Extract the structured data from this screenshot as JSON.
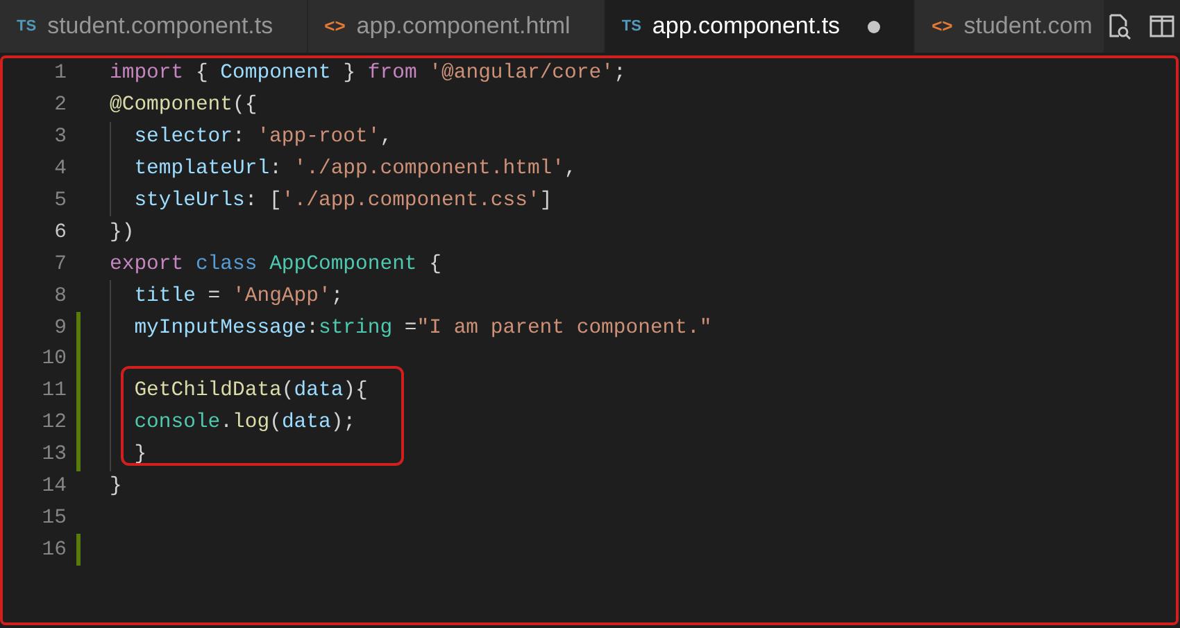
{
  "tabs": [
    {
      "kind": "ts",
      "icon": "TS",
      "label": "student.component.ts",
      "selected": false,
      "modified": false
    },
    {
      "kind": "html",
      "icon": "<>",
      "label": "app.component.html",
      "selected": false,
      "modified": false
    },
    {
      "kind": "ts",
      "icon": "TS",
      "label": "app.component.ts",
      "selected": true,
      "modified": true
    },
    {
      "kind": "html",
      "icon": "<>",
      "label": "student.com",
      "selected": false,
      "modified": false
    }
  ],
  "editor": {
    "lines": [
      {
        "number": "1",
        "current": false,
        "changed": false,
        "indented": false,
        "tokens": [
          {
            "color": "#c586c0",
            "text": "import"
          },
          {
            "color": "#d4d4d4",
            "text": " { "
          },
          {
            "color": "#9cdcfe",
            "text": "Component"
          },
          {
            "color": "#d4d4d4",
            "text": " } "
          },
          {
            "color": "#c586c0",
            "text": "from"
          },
          {
            "color": "#ce9178",
            "text": " '@angular/core'"
          },
          {
            "color": "#d4d4d4",
            "text": ";"
          }
        ]
      },
      {
        "number": "2",
        "current": false,
        "changed": false,
        "indented": false,
        "tokens": [
          {
            "color": "#dcdcaa",
            "text": "@Component"
          },
          {
            "color": "#d4d4d4",
            "text": "({"
          }
        ]
      },
      {
        "number": "3",
        "current": false,
        "changed": false,
        "indented": true,
        "tokens": [
          {
            "color": "#9cdcfe",
            "text": "selector"
          },
          {
            "color": "#d4d4d4",
            "text": ": "
          },
          {
            "color": "#ce9178",
            "text": "'app-root'"
          },
          {
            "color": "#d4d4d4",
            "text": ","
          }
        ]
      },
      {
        "number": "4",
        "current": false,
        "changed": false,
        "indented": true,
        "tokens": [
          {
            "color": "#9cdcfe",
            "text": "templateUrl"
          },
          {
            "color": "#d4d4d4",
            "text": ": "
          },
          {
            "color": "#ce9178",
            "text": "'./app.component.html'"
          },
          {
            "color": "#d4d4d4",
            "text": ","
          }
        ]
      },
      {
        "number": "5",
        "current": false,
        "changed": false,
        "indented": true,
        "tokens": [
          {
            "color": "#9cdcfe",
            "text": "styleUrls"
          },
          {
            "color": "#d4d4d4",
            "text": ": ["
          },
          {
            "color": "#ce9178",
            "text": "'./app.component.css'"
          },
          {
            "color": "#d4d4d4",
            "text": "]"
          }
        ]
      },
      {
        "number": "6",
        "current": true,
        "changed": false,
        "indented": false,
        "tokens": [
          {
            "color": "#d4d4d4",
            "text": "})"
          }
        ]
      },
      {
        "number": "7",
        "current": false,
        "changed": false,
        "indented": false,
        "tokens": [
          {
            "color": "#c586c0",
            "text": "export"
          },
          {
            "color": "#569cd6",
            "text": " class"
          },
          {
            "color": "#4ec9b0",
            "text": " AppComponent"
          },
          {
            "color": "#d4d4d4",
            "text": " {"
          }
        ]
      },
      {
        "number": "8",
        "current": false,
        "changed": false,
        "indented": true,
        "tokens": [
          {
            "color": "#9cdcfe",
            "text": "title"
          },
          {
            "color": "#d4d4d4",
            "text": " = "
          },
          {
            "color": "#ce9178",
            "text": "'AngApp'"
          },
          {
            "color": "#d4d4d4",
            "text": ";"
          }
        ]
      },
      {
        "number": "9",
        "current": false,
        "changed": true,
        "indented": true,
        "tokens": [
          {
            "color": "#9cdcfe",
            "text": "myInputMessage"
          },
          {
            "color": "#d4d4d4",
            "text": ":"
          },
          {
            "color": "#4ec9b0",
            "text": "string"
          },
          {
            "color": "#d4d4d4",
            "text": " ="
          },
          {
            "color": "#ce9178",
            "text": "\"I am parent component.\""
          }
        ]
      },
      {
        "number": "10",
        "current": false,
        "changed": true,
        "indented": true
      },
      {
        "number": "11",
        "current": false,
        "changed": true,
        "indented": true,
        "tokens": [
          {
            "color": "#dcdcaa",
            "text": "GetChildData"
          },
          {
            "color": "#d4d4d4",
            "text": "("
          },
          {
            "color": "#9cdcfe",
            "text": "data"
          },
          {
            "color": "#d4d4d4",
            "text": "){"
          }
        ]
      },
      {
        "number": "12",
        "current": false,
        "changed": true,
        "indented": true,
        "tokens": [
          {
            "color": "#4ec9b0",
            "text": "console"
          },
          {
            "color": "#d4d4d4",
            "text": "."
          },
          {
            "color": "#dcdcaa",
            "text": "log"
          },
          {
            "color": "#d4d4d4",
            "text": "("
          },
          {
            "color": "#9cdcfe",
            "text": "data"
          },
          {
            "color": "#d4d4d4",
            "text": ");"
          }
        ]
      },
      {
        "number": "13",
        "current": false,
        "changed": true,
        "indented": true,
        "tokens": [
          {
            "color": "#d4d4d4",
            "text": "}"
          }
        ]
      },
      {
        "number": "14",
        "current": false,
        "changed": false,
        "indented": false,
        "tokens": [
          {
            "color": "#d4d4d4",
            "text": "}"
          }
        ]
      },
      {
        "number": "15",
        "current": false,
        "changed": false,
        "indented": false
      },
      {
        "number": "16",
        "current": false,
        "changed": true,
        "indented": false
      }
    ]
  }
}
